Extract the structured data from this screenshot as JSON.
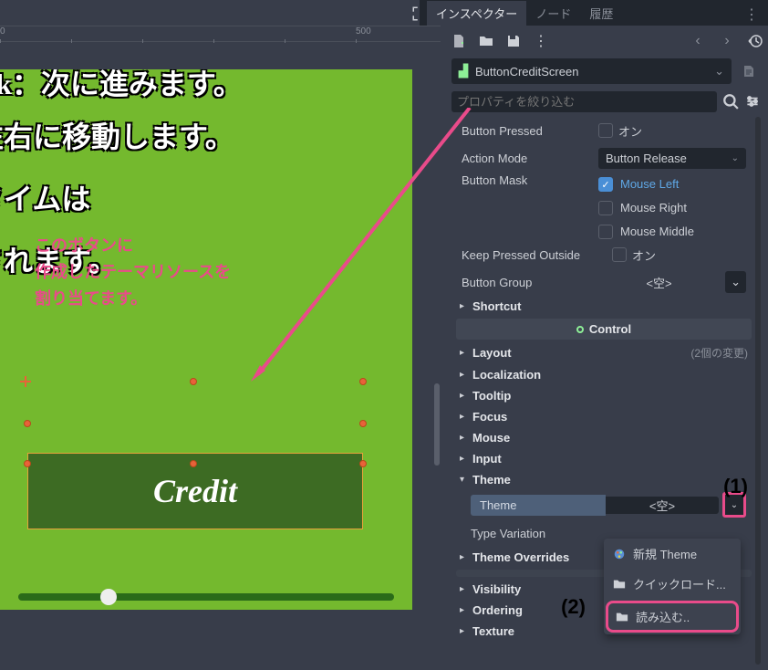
{
  "tabs": {
    "inspector": "インスペクター",
    "node": "ノード",
    "history": "履歴"
  },
  "node_name": "ButtonCreditScreen",
  "filter_placeholder": "プロパティを絞り込む",
  "props": {
    "button_pressed": {
      "label": "Button Pressed",
      "value": "オン"
    },
    "action_mode": {
      "label": "Action Mode",
      "value": "Button Release"
    },
    "button_mask": {
      "label": "Button Mask",
      "opt1": "Mouse Left",
      "opt2": "Mouse Right",
      "opt3": "Mouse Middle"
    },
    "keep_pressed": {
      "label": "Keep Pressed Outside",
      "value": "オン"
    },
    "button_group": {
      "label": "Button Group",
      "value": "<空>"
    },
    "theme": {
      "label": "Theme",
      "value": "<空>"
    },
    "type_variation": {
      "label": "Type Variation"
    }
  },
  "sections": {
    "shortcut": "Shortcut",
    "control": "Control",
    "layout": "Layout",
    "layout_count": "(2個の変更)",
    "localization": "Localization",
    "tooltip": "Tooltip",
    "focus": "Focus",
    "mouse": "Mouse",
    "input": "Input",
    "theme": "Theme",
    "theme_overrides": "Theme Overrides",
    "visibility": "Visibility",
    "ordering": "Ordering",
    "texture": "Texture"
  },
  "popup": {
    "new_theme": "新規 Theme",
    "quick_load": "クイックロード...",
    "load": "読み込む.."
  },
  "annotations": {
    "num1": "(1)",
    "num2": "(2)",
    "overlay_line1": "このボタンに",
    "overlay_line2": "作成したテーマリソースを",
    "overlay_line3": "割り当てます。"
  },
  "canvas": {
    "line1": "Click：次に進みます。",
    "line2": "を左右に移動します。",
    "line3": "のタイムは",
    "line4": "示されます。",
    "credit": "Credit",
    "ruler_0": "0",
    "ruler_500": "500"
  }
}
